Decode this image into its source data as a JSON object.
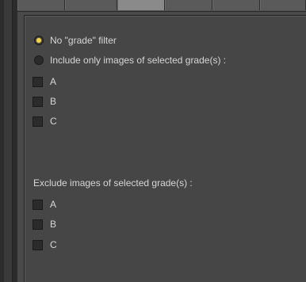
{
  "filters": {
    "no_filter_label": "No \"grade\" filter",
    "include_label": "Include only images of selected grade(s) :",
    "include_grades": [
      "A",
      "B",
      "C"
    ],
    "exclude_label": "Exclude images of selected grade(s) :",
    "exclude_grades": [
      "A",
      "B",
      "C"
    ]
  },
  "colors": {
    "accent": "#f3d34a",
    "background": "#4a4a4a"
  }
}
